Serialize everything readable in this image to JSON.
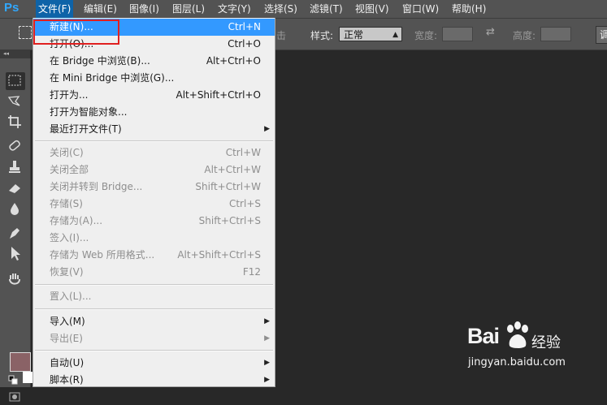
{
  "app": {
    "logo": "Ps"
  },
  "menubar": {
    "items": [
      {
        "label": "文件(F)",
        "active": true
      },
      {
        "label": "编辑(E)"
      },
      {
        "label": "图像(I)"
      },
      {
        "label": "图层(L)"
      },
      {
        "label": "文字(Y)"
      },
      {
        "label": "选择(S)"
      },
      {
        "label": "滤镜(T)"
      },
      {
        "label": "视图(V)"
      },
      {
        "label": "窗口(W)"
      },
      {
        "label": "帮助(H)"
      }
    ]
  },
  "options_bar": {
    "partial_label": "击",
    "style_label": "样式:",
    "style_value": "正常",
    "width_label": "宽度:",
    "height_label": "高度:",
    "right_button": "调"
  },
  "file_menu": {
    "items": [
      {
        "label": "新建(N)...",
        "shortcut": "Ctrl+N",
        "selected": true
      },
      {
        "label": "打开(O)...",
        "shortcut": "Ctrl+O"
      },
      {
        "label": "在 Bridge 中浏览(B)...",
        "shortcut": "Alt+Ctrl+O"
      },
      {
        "label": "在 Mini Bridge 中浏览(G)...",
        "shortcut": ""
      },
      {
        "label": "打开为...",
        "shortcut": "Alt+Shift+Ctrl+O"
      },
      {
        "label": "打开为智能对象...",
        "shortcut": ""
      },
      {
        "label": "最近打开文件(T)",
        "shortcut": "",
        "submenu": true
      },
      {
        "label": "关闭(C)",
        "shortcut": "Ctrl+W",
        "disabled": true
      },
      {
        "label": "关闭全部",
        "shortcut": "Alt+Ctrl+W",
        "disabled": true
      },
      {
        "label": "关闭并转到 Bridge...",
        "shortcut": "Shift+Ctrl+W",
        "disabled": true
      },
      {
        "label": "存储(S)",
        "shortcut": "Ctrl+S",
        "disabled": true
      },
      {
        "label": "存储为(A)...",
        "shortcut": "Shift+Ctrl+S",
        "disabled": true
      },
      {
        "label": "签入(I)...",
        "shortcut": "",
        "disabled": true
      },
      {
        "label": "存储为 Web 所用格式...",
        "shortcut": "Alt+Shift+Ctrl+S",
        "disabled": true
      },
      {
        "label": "恢复(V)",
        "shortcut": "F12",
        "disabled": true
      },
      {
        "label": "置入(L)...",
        "shortcut": "",
        "disabled": true
      },
      {
        "label": "导入(M)",
        "shortcut": "",
        "submenu": true
      },
      {
        "label": "导出(E)",
        "shortcut": "",
        "submenu": true,
        "disabled": true
      },
      {
        "label": "自动(U)",
        "shortcut": "",
        "submenu": true
      },
      {
        "label": "脚本(R)",
        "shortcut": "",
        "submenu": true
      }
    ]
  },
  "watermark": {
    "brand": "Bai",
    "brand2": "经验",
    "url": "jingyan.baidu.com"
  },
  "colors": {
    "accent": "#3399ff",
    "highlight_box": "#e02020",
    "foreground_swatch": "#8a6266"
  }
}
